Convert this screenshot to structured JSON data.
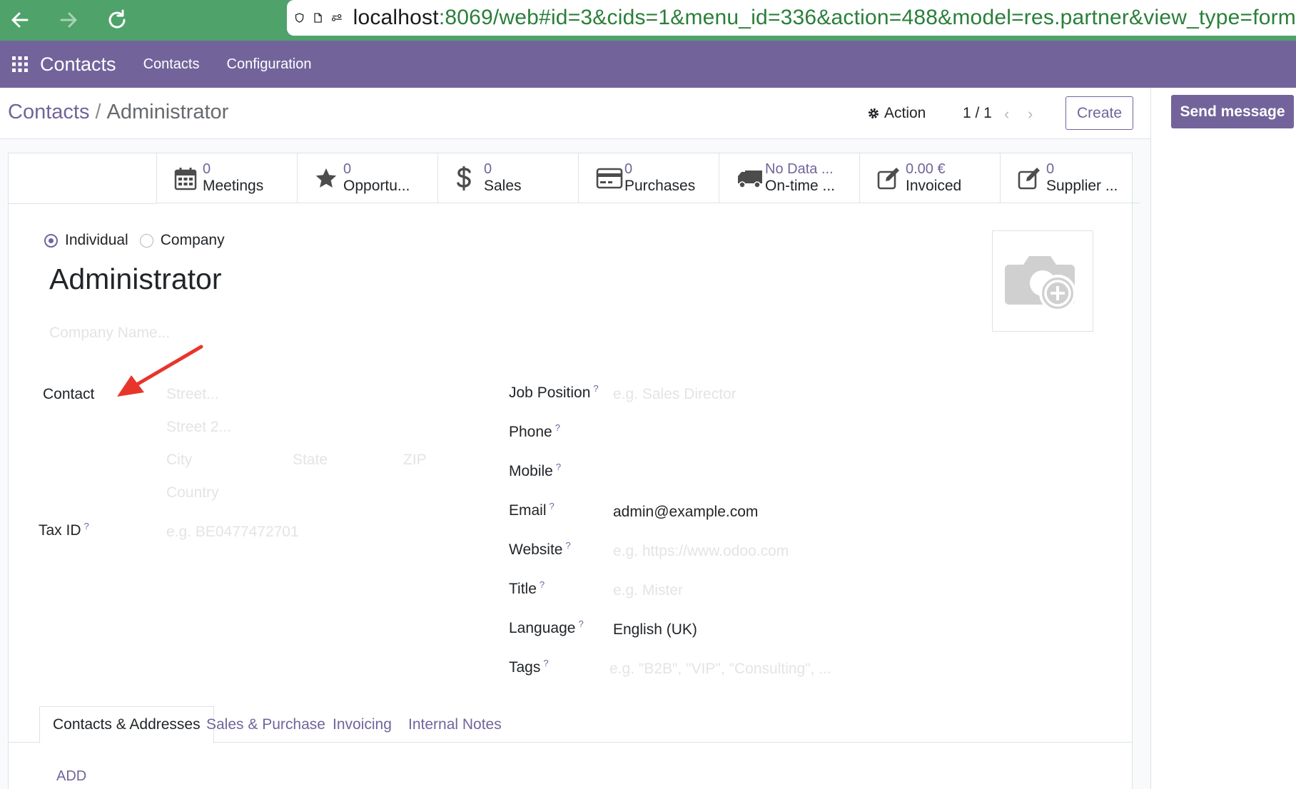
{
  "browser": {
    "url_host": "localhost",
    "url_path": ":8069/web#id=3&cids=1&menu_id=336&action=488&model=res.partner&view_type=form"
  },
  "appnav": {
    "brand": "Contacts",
    "menu": [
      "Contacts",
      "Configuration"
    ]
  },
  "control": {
    "breadcrumb_parent": "Contacts",
    "breadcrumb_sep": "/",
    "breadcrumb_current": "Administrator",
    "action_label": "Action",
    "pager": "1 / 1",
    "create_label": "Create"
  },
  "chatter": {
    "send_message_label": "Send message"
  },
  "stats": [
    {
      "value": "0",
      "label": "Meetings",
      "icon": "calendar-icon"
    },
    {
      "value": "0",
      "label": "Opportu...",
      "icon": "star-icon"
    },
    {
      "value": "0",
      "label": "Sales",
      "icon": "dollar-icon"
    },
    {
      "value": "0",
      "label": "Purchases",
      "icon": "credit-card-icon"
    },
    {
      "value": "No Data ...",
      "label": "On-time ...",
      "icon": "truck-icon"
    },
    {
      "value": "0.00 €",
      "label": "Invoiced",
      "icon": "edit-icon"
    },
    {
      "value": "0",
      "label": "Supplier ...",
      "icon": "edit-icon"
    }
  ],
  "form": {
    "type_individual": "Individual",
    "type_company": "Company",
    "name": "Administrator",
    "company_name_placeholder": "Company Name...",
    "contact_label": "Contact",
    "street_placeholder": "Street...",
    "street2_placeholder": "Street 2...",
    "city_placeholder": "City",
    "state_placeholder": "State",
    "zip_placeholder": "ZIP",
    "country_placeholder": "Country",
    "taxid_label": "Tax ID",
    "taxid_placeholder": "e.g. BE0477472701",
    "job_label": "Job Position",
    "job_placeholder": "e.g. Sales Director",
    "phone_label": "Phone",
    "mobile_label": "Mobile",
    "email_label": "Email",
    "email_value": "admin@example.com",
    "website_label": "Website",
    "website_placeholder": "e.g. https://www.odoo.com",
    "title_label": "Title",
    "title_placeholder": "e.g. Mister",
    "language_label": "Language",
    "language_value": "English (UK)",
    "tags_label": "Tags",
    "tags_placeholder": "e.g. \"B2B\", \"VIP\", \"Consulting\", ...",
    "help_mark": "?"
  },
  "tabs": [
    "Contacts & Addresses",
    "Sales & Purchase",
    "Invoicing",
    "Internal Notes"
  ],
  "add_label": "ADD",
  "colors": {
    "brand": "#72649b",
    "browser_bar": "#4ea26a",
    "annotation_arrow": "#e8352b"
  }
}
